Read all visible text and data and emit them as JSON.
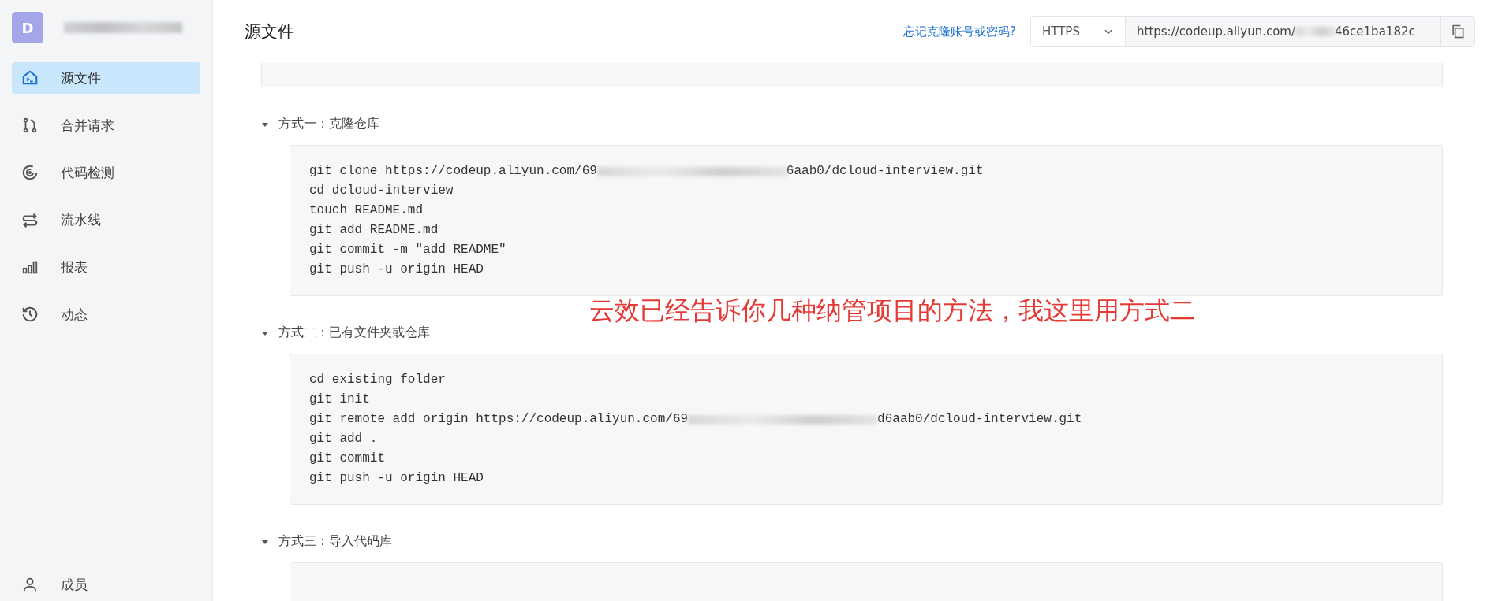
{
  "sidebar": {
    "avatar": "D",
    "items": [
      {
        "label": "源文件",
        "selected": true
      },
      {
        "label": "合并请求",
        "selected": false
      },
      {
        "label": "代码检测",
        "selected": false
      },
      {
        "label": "流水线",
        "selected": false
      },
      {
        "label": "报表",
        "selected": false
      },
      {
        "label": "动态",
        "selected": false
      }
    ],
    "footer_item": {
      "label": "成员"
    }
  },
  "header": {
    "title": "源文件",
    "help_link": "忘记克隆账号或密码?",
    "protocol": "HTTPS",
    "clone_url": [
      "https://codeup.aliyun.com/",
      "46ce1ba182c"
    ]
  },
  "sections": [
    {
      "title": "方式一：克隆仓库",
      "expanded": true,
      "lines": [
        [
          "git clone https://codeup.aliyun.com/69",
          "6aab0/dcloud-interview.git"
        ],
        [
          "cd dcloud-interview"
        ],
        [
          "touch README.md"
        ],
        [
          "git add README.md"
        ],
        [
          "git commit -m \"add README\""
        ],
        [
          "git push -u origin HEAD"
        ]
      ]
    },
    {
      "title": "方式二：已有文件夹或仓库",
      "expanded": true,
      "lines": [
        [
          "cd existing_folder"
        ],
        [
          "git init"
        ],
        [
          "git remote add origin https://codeup.aliyun.com/69",
          "d6aab0/dcloud-interview.git"
        ],
        [
          "git add ."
        ],
        [
          "git commit"
        ],
        [
          "git push -u origin HEAD"
        ]
      ]
    },
    {
      "title": "方式三：导入代码库",
      "expanded": true
    }
  ],
  "annotation": "云效已经告诉你几种纳管项目的方法，我这里用方式二"
}
